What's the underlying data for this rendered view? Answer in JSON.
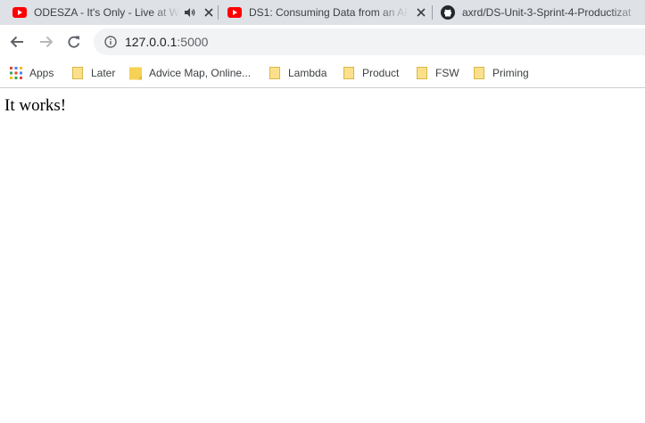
{
  "browser": {
    "tabs": [
      {
        "title": "ODESZA - It's Only - Live at Wa",
        "favicon": "youtube-icon",
        "audio": true
      },
      {
        "title": "DS1: Consuming Data from an API",
        "favicon": "youtube-icon",
        "audio": false
      },
      {
        "title": "axrd/DS-Unit-3-Sprint-4-Productizat",
        "favicon": "github-icon",
        "audio": false
      }
    ],
    "address": {
      "host": "127.0.0.1",
      "port": ":5000",
      "icon": "info-icon"
    },
    "bookmarks": [
      {
        "label": "Apps",
        "icon": "apps-grid-icon"
      },
      {
        "label": "Later",
        "icon": "folder-icon"
      },
      {
        "label": "Advice Map, Online...",
        "icon": "sticky-note-icon"
      },
      {
        "label": "Lambda",
        "icon": "folder-icon"
      },
      {
        "label": "Product",
        "icon": "folder-icon"
      },
      {
        "label": "FSW",
        "icon": "folder-icon"
      },
      {
        "label": "Priming",
        "icon": "folder-icon"
      }
    ]
  },
  "colors": {
    "tabstrip": "#dee1e6",
    "youtube_red": "#ff0000",
    "omnibox_bg": "#f1f3f4",
    "folder_yellow": "#f7d154"
  },
  "page": {
    "text": "It works!"
  }
}
